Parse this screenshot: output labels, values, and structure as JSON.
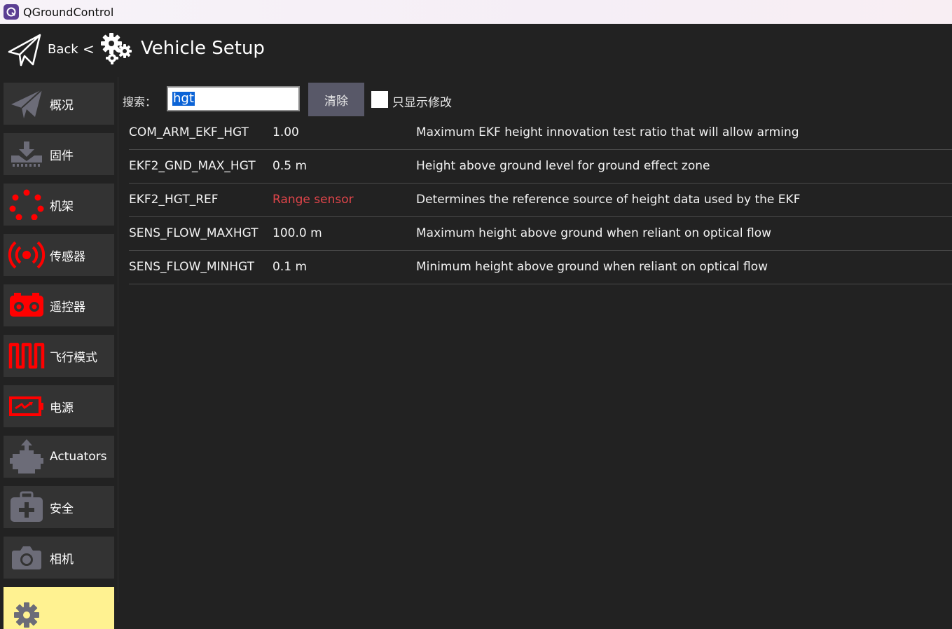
{
  "window": {
    "title": "QGroundControl"
  },
  "header": {
    "back_label": "Back",
    "separator": "<",
    "title": "Vehicle Setup"
  },
  "sidebar": {
    "items": [
      {
        "label": "概况",
        "icon": "paper-plane-icon"
      },
      {
        "label": "固件",
        "icon": "download-icon"
      },
      {
        "label": "机架",
        "icon": "airframe-dots-icon"
      },
      {
        "label": "传感器",
        "icon": "sensor-radio-icon"
      },
      {
        "label": "遥控器",
        "icon": "remote-controller-icon"
      },
      {
        "label": "飞行模式",
        "icon": "flight-mode-wave-icon"
      },
      {
        "label": "电源",
        "icon": "battery-icon"
      },
      {
        "label": "Actuators",
        "icon": "actuator-icon"
      },
      {
        "label": "安全",
        "icon": "first-aid-kit-icon"
      },
      {
        "label": "相机",
        "icon": "camera-icon"
      },
      {
        "label": "",
        "icon": "gear-icon"
      }
    ]
  },
  "search": {
    "label": "搜索：",
    "value": "hgt",
    "clear_label": "清除",
    "modified_only_label": "只显示修改"
  },
  "params": [
    {
      "name": "COM_ARM_EKF_HGT",
      "value": "1.00",
      "description": "Maximum EKF height innovation test ratio that will allow arming",
      "non_default": false
    },
    {
      "name": "EKF2_GND_MAX_HGT",
      "value": "0.5 m",
      "description": "Height above ground level for ground effect zone",
      "non_default": false
    },
    {
      "name": "EKF2_HGT_REF",
      "value": "Range sensor",
      "description": "Determines the reference source of height data used by the EKF",
      "non_default": true
    },
    {
      "name": "SENS_FLOW_MAXHGT",
      "value": "100.0 m",
      "description": "Maximum height above ground when reliant on optical flow",
      "non_default": false
    },
    {
      "name": "SENS_FLOW_MINHGT",
      "value": "0.1 m",
      "description": "Minimum height above ground when reliant on optical flow",
      "non_default": false
    }
  ],
  "colors": {
    "accent_active": "#fff291",
    "warning_red": "#ff0000",
    "non_default_value": "#e0454a"
  }
}
